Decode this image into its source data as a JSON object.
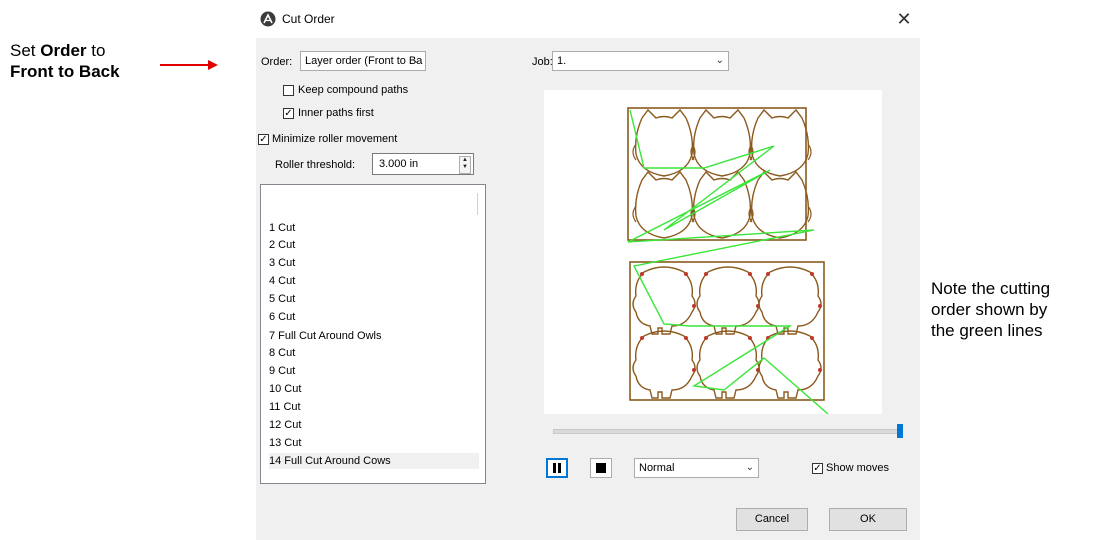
{
  "annotations": {
    "left_prefix": "Set ",
    "left_bold1": "Order",
    "left_mid": " to",
    "left_line2": "Front to Back",
    "right_line1": "Note the cutting",
    "right_line2": "order shown by",
    "right_line3": "the green lines",
    "arrow_color": "#e00000"
  },
  "dialog": {
    "title": "Cut Order",
    "close_glyph": "✕",
    "order_label": "Order:",
    "order_value": "Layer order (Front to Ba",
    "job_label": "Job:",
    "job_value": "1.",
    "keep_compound": {
      "label": "Keep compound paths",
      "checked": false
    },
    "inner_paths": {
      "label": "Inner paths first",
      "checked": true
    },
    "minimize_roller": {
      "label": "Minimize roller movement",
      "checked": true
    },
    "roller_threshold_label": "Roller threshold:",
    "roller_threshold_value": "3.000 in",
    "list_items": [
      "1 Cut",
      "2 Cut",
      "3 Cut",
      "4 Cut",
      "5 Cut",
      "6 Cut",
      "7 Full Cut Around Owls",
      "8 Cut",
      "9 Cut",
      "10 Cut",
      "11 Cut",
      "12 Cut",
      "13 Cut",
      "14 Full Cut Around Cows"
    ],
    "selected_item": "14 Full Cut Around Cows",
    "speed_value": "Normal",
    "show_moves": {
      "label": "Show moves",
      "checked": true
    },
    "cancel_label": "Cancel",
    "ok_label": "OK",
    "cut_color": "#8b5a1e",
    "move_color": "#39e639"
  }
}
